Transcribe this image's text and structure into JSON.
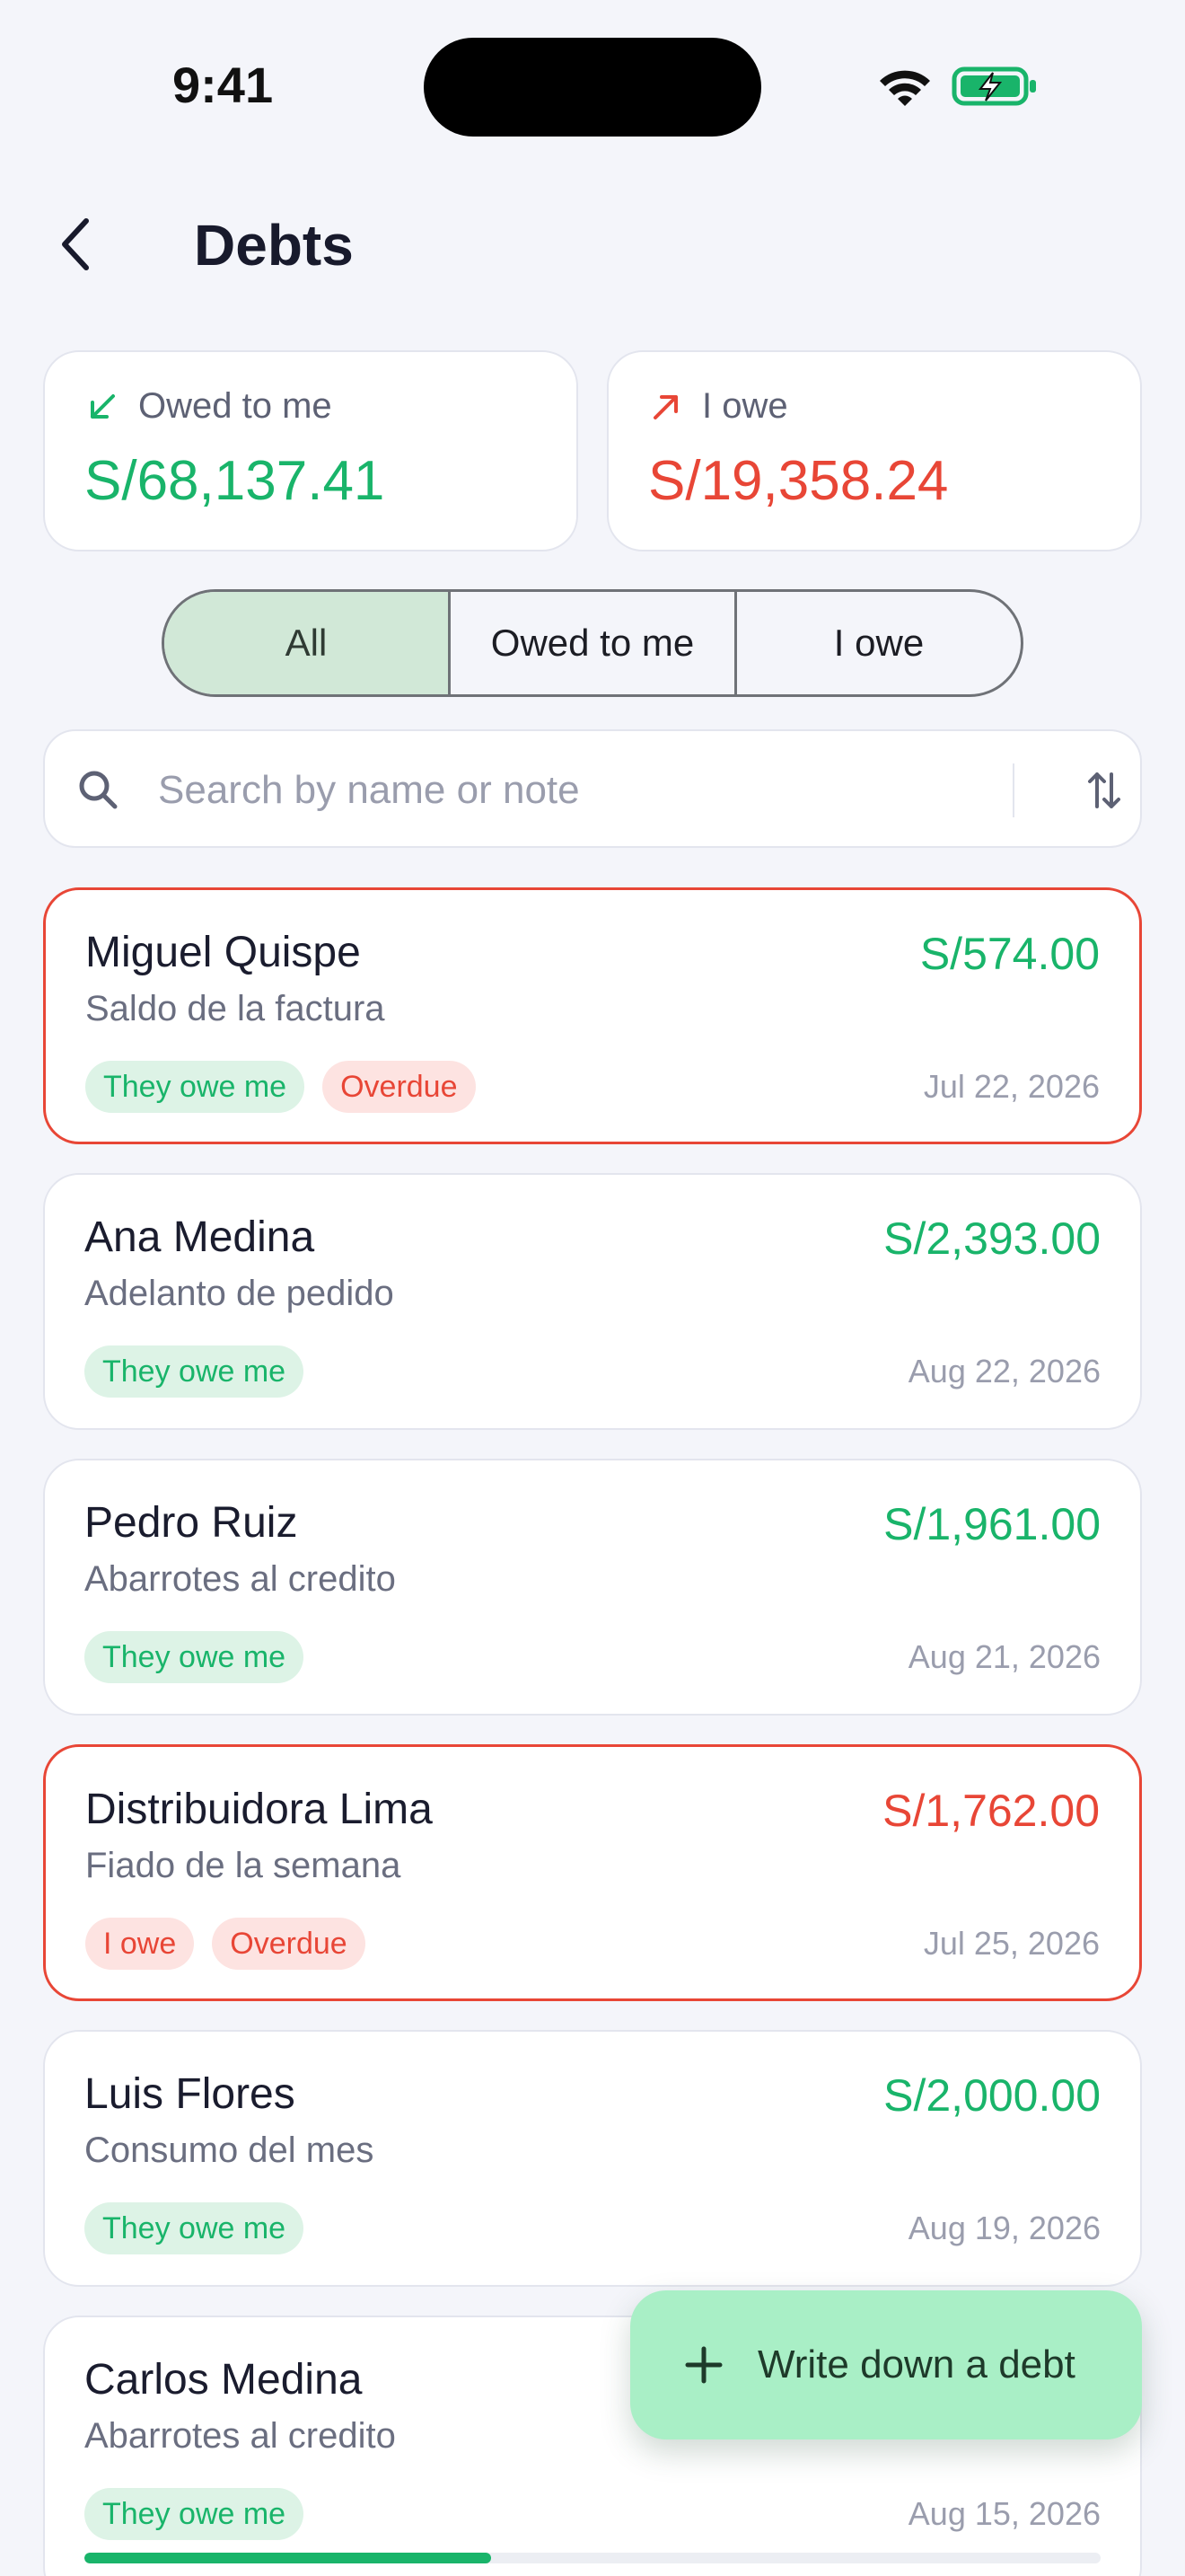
{
  "status_bar": {
    "time": "9:41"
  },
  "header": {
    "title": "Debts"
  },
  "summary": {
    "owed_to_me": {
      "label": "Owed to me",
      "amount": "S/68,137.41",
      "icon": "arrow-down-left-icon"
    },
    "i_owe": {
      "label": "I owe",
      "amount": "S/19,358.24",
      "icon": "arrow-up-right-icon"
    }
  },
  "filters": {
    "options": [
      "All",
      "Owed to me",
      "I owe"
    ],
    "selected": "All"
  },
  "search": {
    "placeholder": "Search by name or note",
    "value": ""
  },
  "debts": [
    {
      "name": "Miguel Quispe",
      "amount": "S/574.00",
      "note": "Saldo de la factura",
      "tags": [
        "They owe me",
        "Overdue"
      ],
      "date": "Jul 22, 2026",
      "direction": "owed",
      "overdue": true
    },
    {
      "name": "Ana Medina",
      "amount": "S/2,393.00",
      "note": "Adelanto de pedido",
      "tags": [
        "They owe me"
      ],
      "date": "Aug 22, 2026",
      "direction": "owed",
      "overdue": false
    },
    {
      "name": "Pedro Ruiz",
      "amount": "S/1,961.00",
      "note": "Abarrotes al credito",
      "tags": [
        "They owe me"
      ],
      "date": "Aug 21, 2026",
      "direction": "owed",
      "overdue": false
    },
    {
      "name": "Distribuidora Lima",
      "amount": "S/1,762.00",
      "note": "Fiado de la semana",
      "tags": [
        "I owe",
        "Overdue"
      ],
      "date": "Jul 25, 2026",
      "direction": "owe",
      "overdue": true
    },
    {
      "name": "Luis Flores",
      "amount": "S/2,000.00",
      "note": "Consumo del mes",
      "tags": [
        "They owe me"
      ],
      "date": "Aug 19, 2026",
      "direction": "owed",
      "overdue": false
    },
    {
      "name": "Carlos Medina",
      "amount": "",
      "note": "Abarrotes al credito",
      "tags": [
        "They owe me"
      ],
      "date": "Aug 15, 2026",
      "direction": "owed",
      "overdue": false,
      "paid_fraction": 0.4
    }
  ],
  "fab": {
    "label": "Write down a debt",
    "icon": "plus-icon"
  },
  "colors": {
    "positive": "#19b46a",
    "negative": "#e84636",
    "accent_bg": "#a9efc6",
    "selected_segment": "#d1e8d7"
  }
}
